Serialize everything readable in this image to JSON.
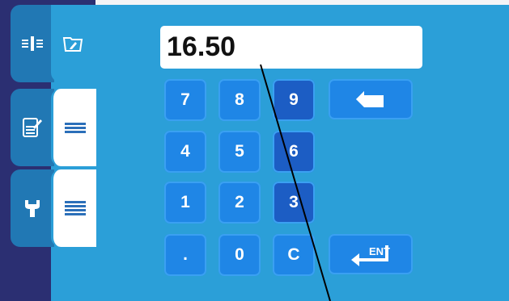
{
  "display": {
    "value": "16.50"
  },
  "keypad": {
    "k7": "7",
    "k8": "8",
    "k9": "9",
    "k4": "4",
    "k5": "5",
    "k6": "6",
    "k1": "1",
    "k2": "2",
    "k3": "3",
    "dot": ".",
    "k0": "0",
    "clear": "C",
    "enter": "ENT"
  },
  "colors": {
    "panel": "#2b9fd8",
    "sidebar": "#2b2f72",
    "key": "#1f86e6",
    "tab": "#2178b4"
  },
  "icons": {
    "tab1_left": "sliders-align-icon",
    "tab1_right": "folder-edit-icon",
    "tab2_left": "document-edit-icon",
    "tab2_right": "hamburger-icon",
    "tab3_left": "wrench-icon",
    "tab3_right": "hamburger-icon",
    "backspace": "backspace-icon",
    "enter": "enter-arrow-icon"
  }
}
